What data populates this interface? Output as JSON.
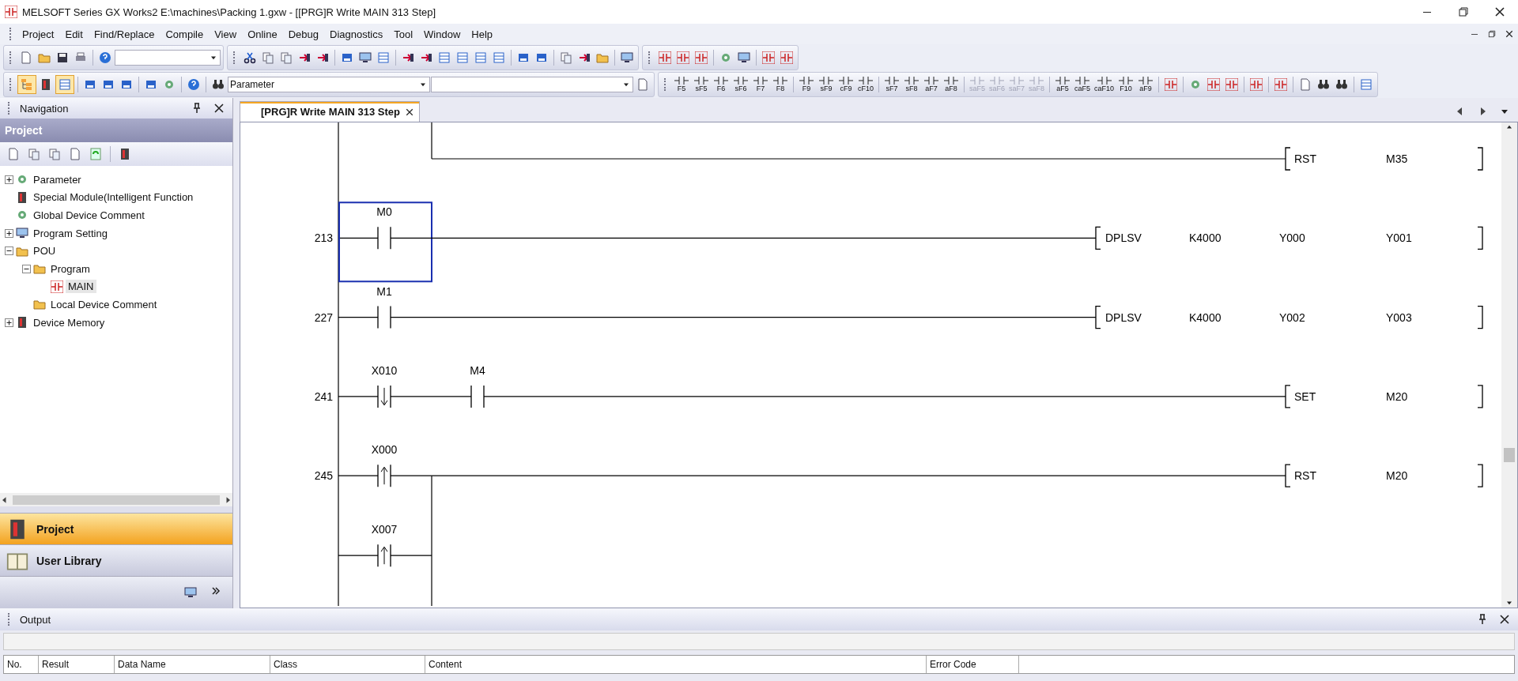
{
  "window": {
    "title": "MELSOFT Series GX Works2 E:\\machines\\Packing 1.gxw - [[PRG]R Write MAIN 313 Step]"
  },
  "menu": [
    "Project",
    "Edit",
    "Find/Replace",
    "Compile",
    "View",
    "Online",
    "Debug",
    "Diagnostics",
    "Tool",
    "Window",
    "Help"
  ],
  "toolbar": {
    "data_combo": "Parameter",
    "ladder_keys": [
      {
        "label": "F5",
        "disabled": false
      },
      {
        "label": "sF5",
        "disabled": false
      },
      {
        "label": "F6",
        "disabled": false
      },
      {
        "label": "sF6",
        "disabled": false
      },
      {
        "label": "F7",
        "disabled": false
      },
      {
        "label": "F8",
        "disabled": false
      },
      {
        "label": "F9",
        "disabled": false
      },
      {
        "label": "sF9",
        "disabled": false
      },
      {
        "label": "cF9",
        "disabled": false
      },
      {
        "label": "cF10",
        "disabled": false
      },
      {
        "label": "sF7",
        "disabled": false
      },
      {
        "label": "sF8",
        "disabled": false
      },
      {
        "label": "aF7",
        "disabled": false
      },
      {
        "label": "aF8",
        "disabled": false
      },
      {
        "label": "saF5",
        "disabled": true
      },
      {
        "label": "saF6",
        "disabled": true
      },
      {
        "label": "saF7",
        "disabled": true
      },
      {
        "label": "saF8",
        "disabled": true
      },
      {
        "label": "aF5",
        "disabled": false
      },
      {
        "label": "caF5",
        "disabled": false
      },
      {
        "label": "caF10",
        "disabled": false
      },
      {
        "label": "F10",
        "disabled": false
      },
      {
        "label": "aF9",
        "disabled": false
      }
    ]
  },
  "navigation": {
    "title": "Navigation",
    "section": "Project",
    "tree": [
      {
        "label": "Parameter",
        "expanded": false,
        "selected": false
      },
      {
        "label": "Special Module(Intelligent Function",
        "selected": false
      },
      {
        "label": "Global Device Comment",
        "selected": false
      },
      {
        "label": "Program Setting",
        "expanded": false,
        "selected": false
      },
      {
        "label": "POU",
        "expanded": true,
        "selected": false,
        "children": [
          {
            "label": "Program",
            "expanded": true,
            "selected": false,
            "children": [
              {
                "label": "MAIN",
                "selected": true
              }
            ]
          },
          {
            "label": "Local Device Comment",
            "selected": false
          }
        ]
      },
      {
        "label": "Device Memory",
        "expanded": false,
        "selected": false
      }
    ],
    "panels": [
      {
        "label": "Project",
        "selected": true
      },
      {
        "label": "User Library",
        "selected": false
      }
    ]
  },
  "editor": {
    "tabs": [
      {
        "label": "[PRG]R Write MAIN 313 Step",
        "selected": true
      }
    ],
    "rungs": [
      {
        "kind": "continuation",
        "instruction": [
          "RST",
          "M35"
        ]
      },
      {
        "kind": "rung",
        "step": "213",
        "contacts": [
          {
            "device": "M0",
            "kind": "normal",
            "selected": true
          }
        ],
        "instruction": [
          "DPLSV",
          "K4000",
          "Y000",
          "Y001"
        ]
      },
      {
        "kind": "rung",
        "step": "227",
        "contacts": [
          {
            "device": "M1",
            "kind": "normal",
            "selected": false
          }
        ],
        "instruction": [
          "DPLSV",
          "K4000",
          "Y002",
          "Y003"
        ]
      },
      {
        "kind": "rung",
        "step": "241",
        "contacts": [
          {
            "device": "X010",
            "kind": "falling",
            "selected": false
          },
          {
            "device": "M4",
            "kind": "normal",
            "selected": false
          }
        ],
        "instruction": [
          "SET",
          "M20"
        ]
      },
      {
        "kind": "rung",
        "step": "245",
        "contacts": [
          {
            "device": "X000",
            "kind": "rising",
            "selected": false
          }
        ],
        "instruction": [
          "RST",
          "M20"
        ],
        "branches": [
          {
            "device": "X007",
            "kind": "rising",
            "selected": false
          }
        ]
      }
    ]
  },
  "output": {
    "title": "Output",
    "columns": [
      "No.",
      "Result",
      "Data Name",
      "Class",
      "Content",
      "Error Code"
    ]
  }
}
